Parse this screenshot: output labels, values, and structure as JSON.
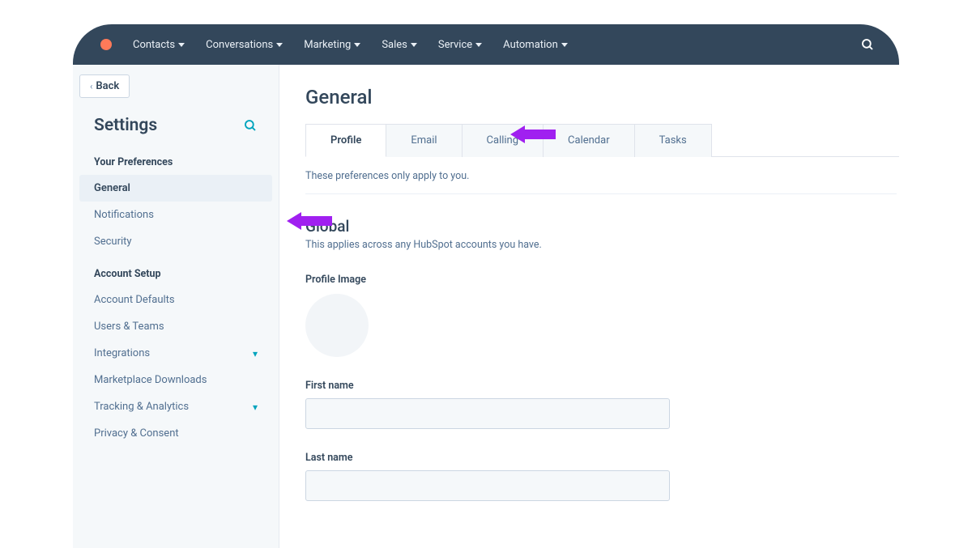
{
  "nav": {
    "items": [
      "Contacts",
      "Conversations",
      "Marketing",
      "Sales",
      "Service",
      "Automation"
    ]
  },
  "sidebar": {
    "back": "Back",
    "title": "Settings",
    "section1_label": "Your Preferences",
    "section1_items": [
      "General",
      "Notifications",
      "Security"
    ],
    "section2_label": "Account Setup",
    "section2_items": [
      "Account Defaults",
      "Users & Teams",
      "Integrations",
      "Marketplace Downloads",
      "Tracking & Analytics",
      "Privacy & Consent"
    ]
  },
  "main": {
    "title": "General",
    "tabs": [
      "Profile",
      "Email",
      "Calling",
      "Calendar",
      "Tasks"
    ],
    "note": "These preferences only apply to you.",
    "global_title": "Global",
    "global_sub": "This applies across any HubSpot accounts you have.",
    "profile_image_label": "Profile Image",
    "first_name_label": "First name",
    "first_name_value": "",
    "last_name_label": "Last name",
    "last_name_value": ""
  },
  "colors": {
    "arrow": "#a020f0"
  }
}
